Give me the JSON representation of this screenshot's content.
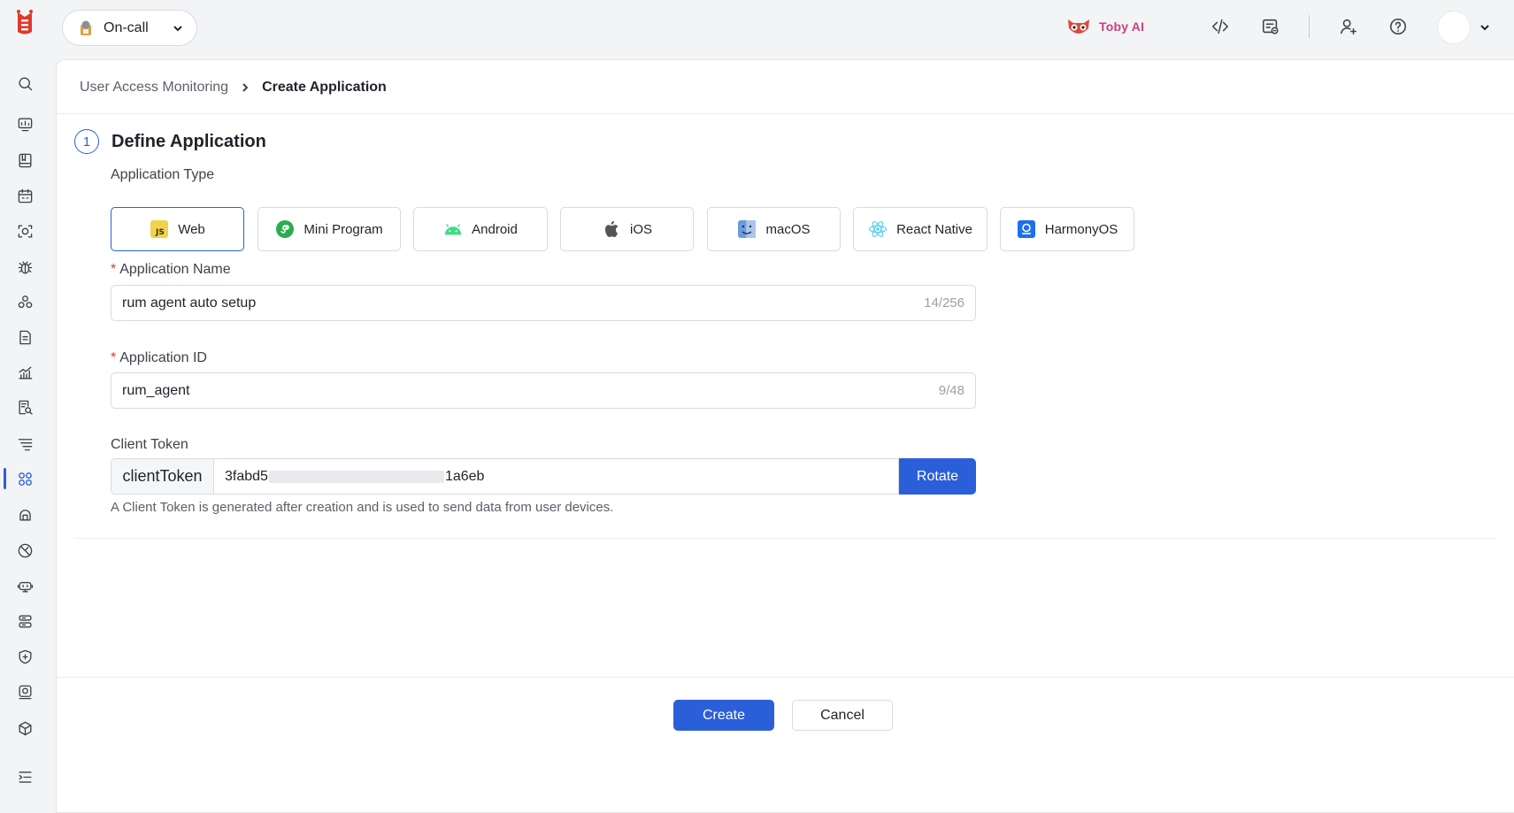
{
  "topbar": {
    "oncall_label": "On-call",
    "ai_label": "Toby AI",
    "icons": [
      "code-icon",
      "notes-icon",
      "add-user-icon",
      "help-icon"
    ]
  },
  "sidebar": {
    "active_index": 11,
    "items": [
      "search-icon",
      "dashboard-icon",
      "book-icon",
      "calendar-icon",
      "scan-icon",
      "bug-icon",
      "apps-icon",
      "document-icon",
      "chart-icon",
      "log-search-icon",
      "filter-icon",
      "grid-icon",
      "cloud-icon",
      "gauge-icon",
      "robot-icon",
      "server-icon",
      "shield-icon",
      "camera-icon",
      "cube-icon",
      "menu-icon"
    ]
  },
  "breadcrumb": {
    "parent": "User Access Monitoring",
    "current": "Create Application"
  },
  "step": {
    "number": "1",
    "title": "Define Application"
  },
  "form": {
    "type_label": "Application Type",
    "types": [
      {
        "label": "Web",
        "icon": "javascript-icon",
        "selected": true
      },
      {
        "label": "Mini Program",
        "icon": "mini-program-icon",
        "selected": false
      },
      {
        "label": "Android",
        "icon": "android-icon",
        "selected": false
      },
      {
        "label": "iOS",
        "icon": "apple-icon",
        "selected": false
      },
      {
        "label": "macOS",
        "icon": "finder-icon",
        "selected": false
      },
      {
        "label": "React Native",
        "icon": "react-icon",
        "selected": false
      },
      {
        "label": "HarmonyOS",
        "icon": "harmonyos-icon",
        "selected": false
      }
    ],
    "name_label": "Application Name",
    "name_value": "rum agent auto setup",
    "name_count": "14/256",
    "id_label": "Application ID",
    "id_value": "rum_agent",
    "id_count": "9/48",
    "token_label": "Client Token",
    "token_prefix": "clientToken",
    "token_start": "3fabd5",
    "token_end": "1a6eb",
    "rotate_label": "Rotate",
    "token_hint": "A Client Token is generated after creation and is used to send data from user devices.",
    "required_mark": "*"
  },
  "footer": {
    "create_label": "Create",
    "cancel_label": "Cancel"
  },
  "colors": {
    "accent": "#2b5fd9",
    "required": "#e0392b",
    "ai_brand": "#c9417f"
  }
}
